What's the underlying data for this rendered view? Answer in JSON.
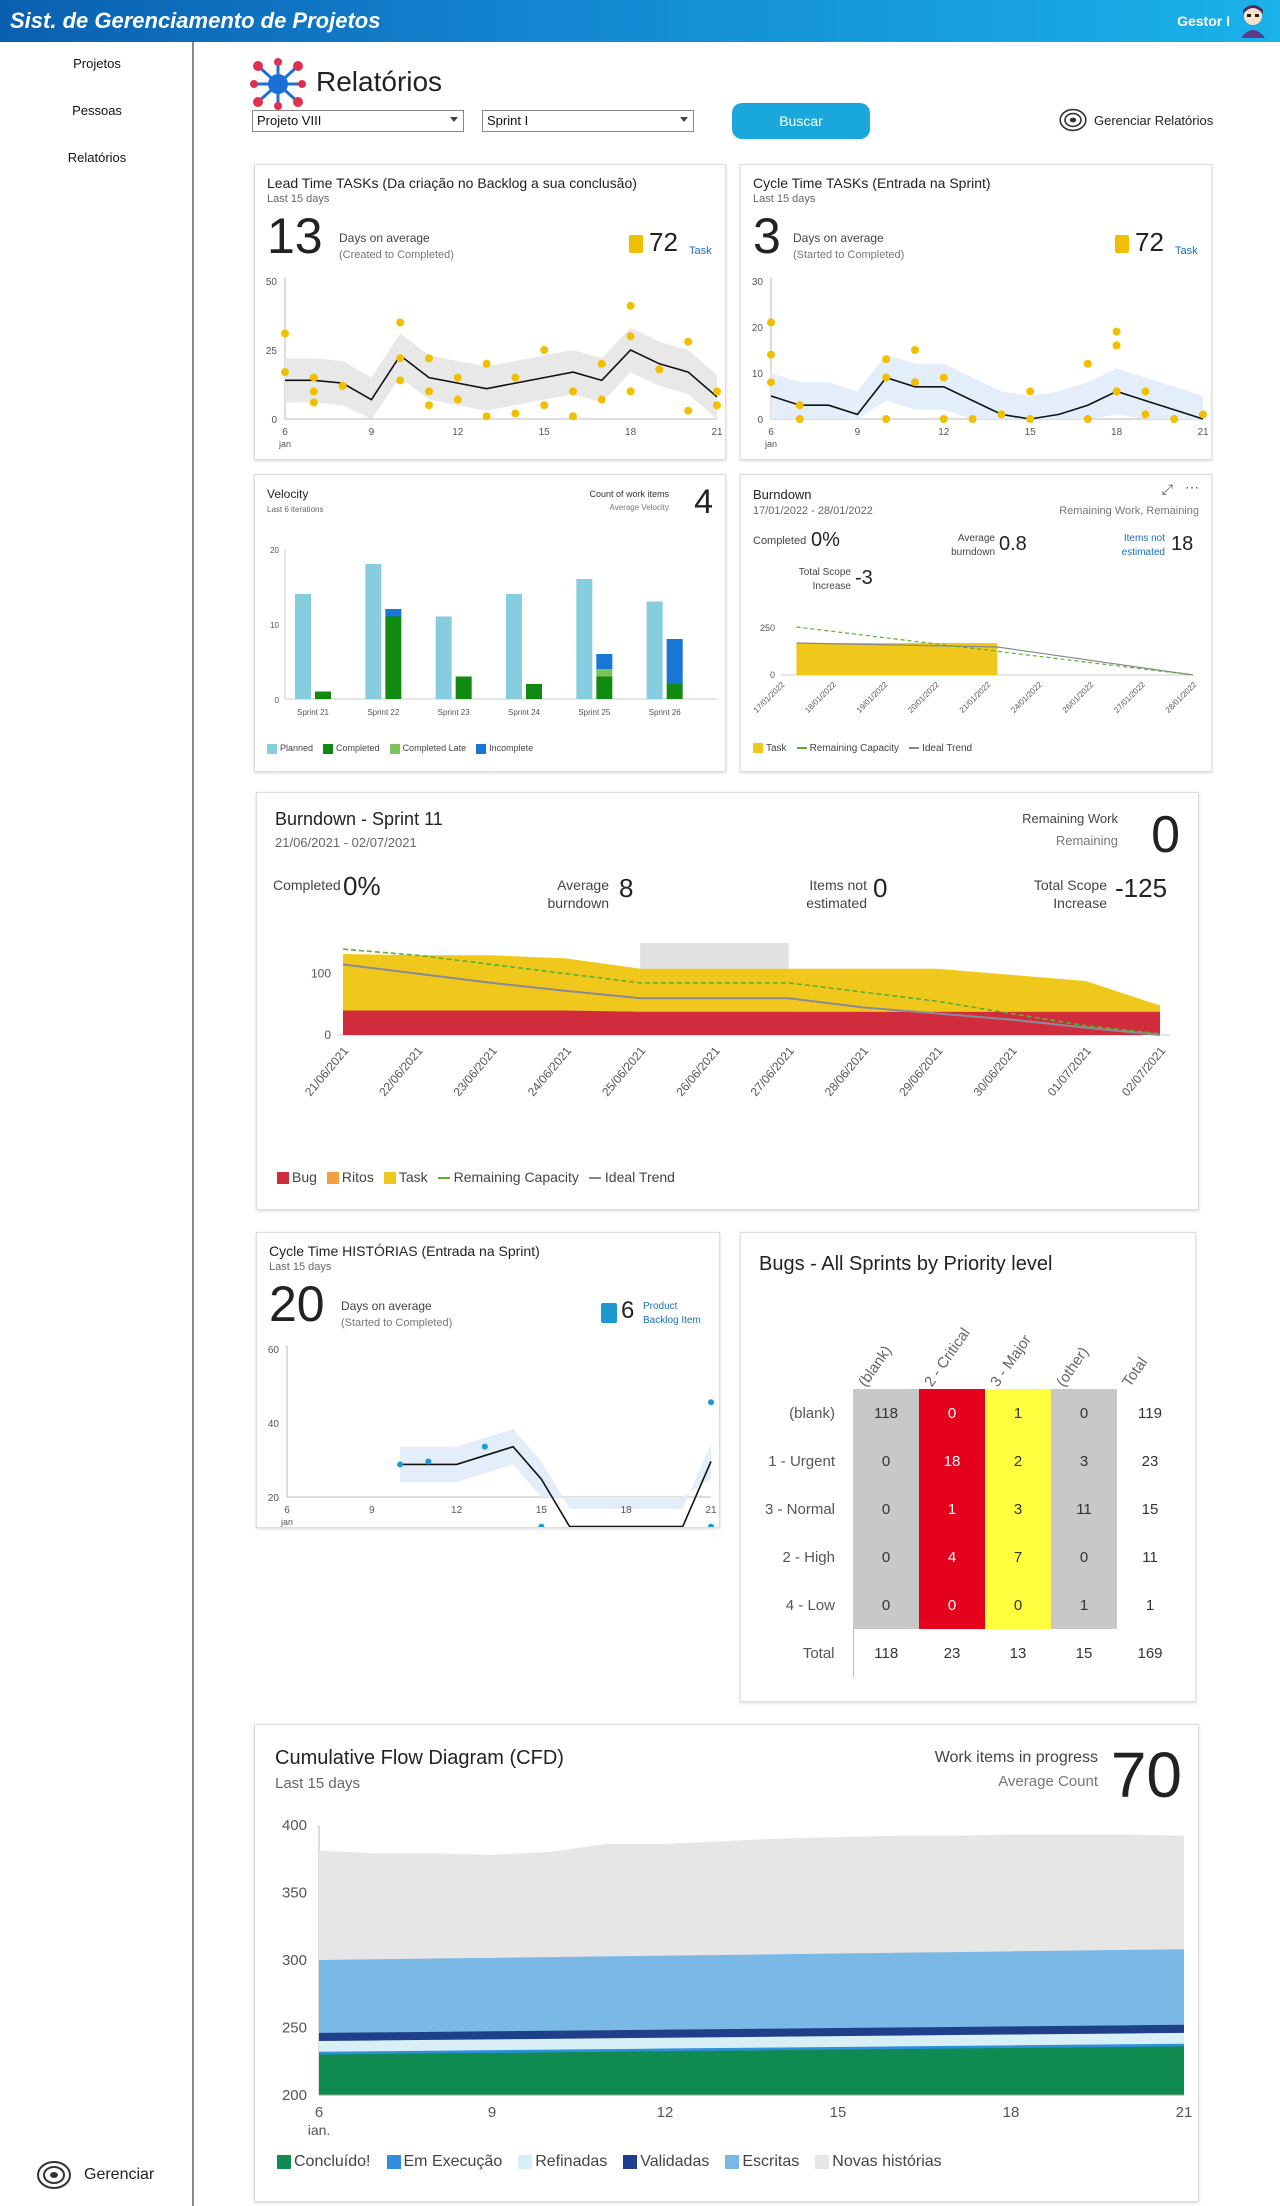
{
  "app": {
    "title": "Sist. de Gerenciamento de Projetos",
    "user": "Gestor I"
  },
  "sidebar": {
    "items": [
      "Projetos",
      "Pessoas",
      "Relatórios"
    ],
    "bottom_label": "Gerenciar"
  },
  "page": {
    "title": "Relatórios",
    "project_select": "Projeto VIII",
    "sprint_select": "Sprint I",
    "search_button": "Buscar",
    "manage_reports": "Gerenciar Relatórios"
  },
  "lead_time": {
    "title": "Lead Time TASKs (Da criação no Backlog a sua conclusão)",
    "subtitle": "Last 15 days",
    "big": "13",
    "desc1": "Days on average",
    "desc2": "(Created to Completed)",
    "count": "72",
    "count_label": "Task",
    "chart_data": {
      "type": "line",
      "x": [
        6,
        7,
        8,
        9,
        10,
        11,
        12,
        13,
        14,
        15,
        16,
        17,
        18,
        19,
        20,
        21
      ],
      "avg": [
        14,
        14,
        13,
        7,
        23,
        15,
        13,
        11,
        13,
        15,
        17,
        14,
        25,
        20,
        17,
        8
      ],
      "yticks": [
        "50",
        "25",
        "0"
      ],
      "xticks": [
        "6",
        "9",
        "12",
        "15",
        "18",
        "21"
      ],
      "xsub": "jan",
      "points": [
        [
          6,
          17
        ],
        [
          6,
          31
        ],
        [
          7,
          6
        ],
        [
          7,
          10
        ],
        [
          7,
          15
        ],
        [
          8,
          12
        ],
        [
          10,
          35
        ],
        [
          10,
          22
        ],
        [
          10,
          14
        ],
        [
          11,
          22
        ],
        [
          11,
          10
        ],
        [
          11,
          5
        ],
        [
          12,
          15
        ],
        [
          12,
          7
        ],
        [
          13,
          1
        ],
        [
          13,
          20
        ],
        [
          14,
          2
        ],
        [
          14,
          15
        ],
        [
          15,
          5
        ],
        [
          15,
          25
        ],
        [
          16,
          1
        ],
        [
          16,
          10
        ],
        [
          17,
          7
        ],
        [
          17,
          20
        ],
        [
          18,
          41
        ],
        [
          18,
          30
        ],
        [
          18,
          10
        ],
        [
          19,
          18
        ],
        [
          20,
          28
        ],
        [
          20,
          3
        ],
        [
          21,
          10
        ],
        [
          21,
          5
        ]
      ]
    }
  },
  "cycle_time": {
    "title": "Cycle Time TASKs (Entrada na Sprint)",
    "subtitle": "Last 15 days",
    "big": "3",
    "desc1": "Days on average",
    "desc2": "(Started to Completed)",
    "count": "72",
    "count_label": "Task",
    "chart_data": {
      "type": "line",
      "x": [
        6,
        7,
        8,
        9,
        10,
        11,
        12,
        13,
        14,
        15,
        16,
        17,
        18,
        19,
        20,
        21
      ],
      "avg": [
        5,
        3,
        3,
        1,
        9,
        7,
        7,
        4,
        1,
        0,
        1,
        3,
        6,
        4,
        2,
        0
      ],
      "yticks": [
        "30",
        "20",
        "10",
        "0"
      ],
      "xticks": [
        "6",
        "9",
        "12",
        "15",
        "18",
        "21"
      ],
      "xsub": "jan",
      "points": [
        [
          6,
          21
        ],
        [
          6,
          14
        ],
        [
          6,
          8
        ],
        [
          7,
          3
        ],
        [
          7,
          0
        ],
        [
          10,
          13
        ],
        [
          10,
          9
        ],
        [
          10,
          0
        ],
        [
          11,
          15
        ],
        [
          11,
          8
        ],
        [
          12,
          9
        ],
        [
          12,
          0
        ],
        [
          13,
          0
        ],
        [
          14,
          1
        ],
        [
          15,
          6
        ],
        [
          15,
          0
        ],
        [
          17,
          12
        ],
        [
          17,
          0
        ],
        [
          18,
          19
        ],
        [
          18,
          16
        ],
        [
          18,
          6
        ],
        [
          19,
          6
        ],
        [
          19,
          1
        ],
        [
          20,
          0
        ],
        [
          21,
          1
        ]
      ]
    }
  },
  "velocity": {
    "title": "Velocity",
    "subtitle": "Last 6 iterations",
    "count_label": "Count of work items",
    "avg_label": "Average Velocity",
    "big": "4",
    "chart_data": {
      "type": "bar",
      "categories": [
        "Sprint 21",
        "Sprint 22",
        "Sprint 23",
        "Sprint 24",
        "Sprint 25",
        "Sprint 26"
      ],
      "series": [
        {
          "name": "Planned",
          "values": [
            14,
            18,
            11,
            14,
            16,
            13
          ],
          "color": "#86cde0"
        },
        {
          "name": "Completed",
          "values": [
            1,
            11,
            3,
            2,
            3,
            2
          ],
          "color": "#108a10"
        },
        {
          "name": "Completed Late",
          "values": [
            0,
            0,
            0,
            0,
            1,
            0
          ],
          "color": "#7cc45a"
        },
        {
          "name": "Incomplete",
          "values": [
            0,
            1,
            0,
            0,
            2,
            6
          ],
          "color": "#1677d4"
        }
      ],
      "yticks": [
        "20",
        "10",
        "0"
      ]
    }
  },
  "burndown_small": {
    "title": "Burndown",
    "dates": "17/01/2022 - 28/01/2022",
    "remaining": "Remaining Work, Remaining",
    "completed_label": "Completed",
    "completed": "0%",
    "avg_label1": "Average",
    "avg_label2": "burndown",
    "avg": "0.8",
    "ne_label1": "Items not",
    "ne_label2": "estimated",
    "ne": "18",
    "scope_label1": "Total Scope",
    "scope_label2": "Increase",
    "scope": "-3",
    "chart_data": {
      "type": "area",
      "categories": [
        "17/01/2022",
        "18/01/2022",
        "19/01/2022",
        "20/01/2022",
        "21/01/2022",
        "24/01/2022",
        "26/01/2022",
        "27/01/2022",
        "28/01/2022"
      ],
      "yticks": [
        "250",
        "0"
      ],
      "legend": [
        "Task",
        "Remaining Capacity",
        "Ideal Trend"
      ]
    }
  },
  "burndown_sprint": {
    "title": "Burndown - Sprint 11",
    "dates": "21/06/2021 - 02/07/2021",
    "remaining1": "Remaining Work",
    "remaining2": "Remaining",
    "big": "0",
    "completed_label": "Completed",
    "completed": "0%",
    "avg_label1": "Average",
    "avg_label2": "burndown",
    "avg": "8",
    "ne_label1": "Items not",
    "ne_label2": "estimated",
    "ne": "0",
    "scope_label1": "Total Scope",
    "scope_label2": "Increase",
    "scope": "-125",
    "chart_data": {
      "type": "area",
      "categories": [
        "21/06/2021",
        "22/06/2021",
        "23/06/2021",
        "24/06/2021",
        "25/06/2021",
        "26/06/2021",
        "27/06/2021",
        "28/06/2021",
        "29/06/2021",
        "30/06/2021",
        "01/07/2021",
        "02/07/2021"
      ],
      "series": [
        {
          "name": "Bug",
          "values": [
            40,
            40,
            40,
            40,
            38,
            38,
            38,
            38,
            38,
            38,
            38,
            38
          ],
          "color": "#d12c3c"
        },
        {
          "name": "Ritos",
          "values": [
            0,
            0,
            0,
            0,
            0,
            0,
            0,
            0,
            0,
            0,
            0,
            0
          ],
          "color": "#f2a040"
        },
        {
          "name": "Task",
          "values": [
            92,
            90,
            90,
            85,
            70,
            70,
            70,
            70,
            70,
            60,
            50,
            10
          ],
          "color": "#f0c81c"
        }
      ],
      "ideal": [
        115,
        100,
        85,
        72,
        60,
        60,
        60,
        45,
        35,
        25,
        12,
        0
      ],
      "capacity": [
        140,
        130,
        115,
        100,
        85,
        85,
        85,
        70,
        55,
        35,
        15,
        2
      ],
      "yticks": [
        "100",
        "0"
      ],
      "legend": [
        "Bug",
        "Ritos",
        "Task",
        "Remaining Capacity",
        "Ideal Trend"
      ]
    }
  },
  "cycle_hist": {
    "title": "Cycle Time HISTÓRIAS (Entrada na Sprint)",
    "subtitle": "Last 15 days",
    "big": "20",
    "desc1": "Days on average",
    "desc2": "(Started to Completed)",
    "count": "6",
    "count_label1": "Product",
    "count_label2": "Backlog Item",
    "chart_data": {
      "type": "line",
      "x": [
        10,
        11,
        12,
        13,
        14,
        15,
        16,
        17,
        18,
        19,
        20,
        21
      ],
      "avg": [
        21,
        21,
        21,
        24,
        27,
        16,
        0,
        0,
        0,
        0,
        0,
        22
      ],
      "yticks": [
        "60",
        "40",
        "20"
      ],
      "xticks": [
        "6",
        "9",
        "12",
        "15",
        "18",
        "21"
      ],
      "xsub": "jan",
      "points": [
        [
          10,
          21
        ],
        [
          11,
          22
        ],
        [
          13,
          27
        ],
        [
          15,
          0
        ],
        [
          21,
          42
        ],
        [
          21,
          0
        ]
      ]
    }
  },
  "bugs": {
    "title": "Bugs - All Sprints by Priority level",
    "columns": [
      "(blank)",
      "2 - Critical",
      "3 - Major",
      "(other)",
      "Total"
    ],
    "rows": [
      {
        "label": "(blank)",
        "values": [
          "118",
          "0",
          "1",
          "0",
          "119"
        ]
      },
      {
        "label": "1 - Urgent",
        "values": [
          "0",
          "18",
          "2",
          "3",
          "23"
        ]
      },
      {
        "label": "3 - Normal",
        "values": [
          "0",
          "1",
          "3",
          "11",
          "15"
        ]
      },
      {
        "label": "2 - High",
        "values": [
          "0",
          "4",
          "7",
          "0",
          "11"
        ]
      },
      {
        "label": "4 - Low",
        "values": [
          "0",
          "0",
          "0",
          "1",
          "1"
        ]
      }
    ],
    "total": {
      "label": "Total",
      "values": [
        "118",
        "23",
        "13",
        "15",
        "169"
      ]
    }
  },
  "cfd": {
    "title": "Cumulative Flow Diagram (CFD)",
    "subtitle": "Last 15 days",
    "wip_label": "Work items in progress",
    "avg_label": "Average Count",
    "big": "70",
    "chart_data": {
      "type": "area",
      "x": [
        6,
        7,
        8,
        9,
        10,
        11,
        12,
        13,
        14,
        15,
        16,
        17,
        18,
        19,
        20,
        21
      ],
      "yticks": [
        "400",
        "350",
        "300",
        "250",
        "200"
      ],
      "xticks": [
        "6",
        "9",
        "12",
        "15",
        "18",
        "21"
      ],
      "xsub": "jan.",
      "series": [
        {
          "name": "Concluído!",
          "color": "#0f8a50"
        },
        {
          "name": "Em Execução",
          "color": "#2f8fdc"
        },
        {
          "name": "Refinadas",
          "color": "#d8eff5"
        },
        {
          "name": "Validadas",
          "color": "#1f3f8a"
        },
        {
          "name": "Escritas",
          "color": "#7ab8e6"
        },
        {
          "name": "Novas histórias",
          "color": "#e6e6e6"
        }
      ],
      "top": [
        381,
        379,
        379,
        378,
        380,
        386,
        386,
        388,
        390,
        391,
        392,
        392,
        393,
        393,
        393,
        392
      ]
    }
  }
}
